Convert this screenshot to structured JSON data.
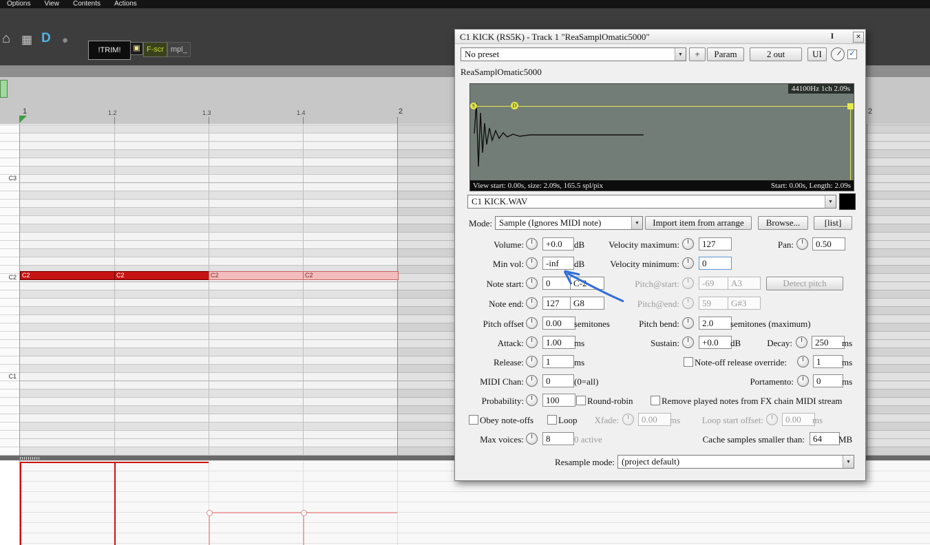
{
  "icons": {
    "home": "⌂",
    "grid": "▦",
    "reaper": "D",
    "monitor": "●",
    "clip": "▣",
    "dropdown": "▼",
    "close": "✕",
    "dock": "I",
    "check": "✓"
  },
  "menu": {
    "items": [
      "Options",
      "View",
      "Contents",
      "Actions"
    ]
  },
  "toolbar": {
    "trim": "!TRIM!",
    "fscr": "F-scr",
    "mpl": "mpl_"
  },
  "ruler": {
    "ticks": [
      "1",
      "1.2",
      "1.3",
      "1.4",
      "2"
    ],
    "right_tick": "2"
  },
  "keys": {
    "labels": [
      "C3",
      "C2",
      "C1"
    ]
  },
  "note": {
    "label": "C2"
  },
  "fx": {
    "title": "C1 KICK (RS5K) - Track 1 \"ReaSamplOmatic5000\"",
    "preset_value": "No preset",
    "add_btn": "+",
    "param_btn": "Param",
    "out_btn": "2 out",
    "ui_btn": "UI",
    "plugin_name": "ReaSamplOmatic5000",
    "wave": {
      "info": "44100Hz 1ch 2.09s",
      "start_marker": "S",
      "loop_marker": "D",
      "view_info": "View start: 0.00s, size: 2.09s, 165.5 spl/pix",
      "range_info": "Start: 0.00s, Length: 2.09s"
    },
    "sample_value": "C1 KICK.WAV",
    "mode_label": "Mode:",
    "mode_value": "Sample (Ignores MIDI note)",
    "import_btn": "Import item from arrange",
    "browse_btn": "Browse...",
    "list_btn": "[list]",
    "params": {
      "volume": {
        "label": "Volume:",
        "value": "+0.0",
        "unit": "dB"
      },
      "vel_max": {
        "label": "Velocity maximum:",
        "value": "127"
      },
      "pan": {
        "label": "Pan:",
        "value": "0.50"
      },
      "min_vol": {
        "label": "Min vol:",
        "value": "-inf",
        "unit": "dB"
      },
      "vel_min": {
        "label": "Velocity minimum:",
        "value": "0"
      },
      "note_start": {
        "label": "Note start:",
        "value": "0",
        "note": "C-2"
      },
      "pitch_start": {
        "label": "Pitch@start:",
        "value": "-69",
        "note": "A3"
      },
      "detect_btn": "Detect pitch",
      "note_end": {
        "label": "Note end:",
        "value": "127",
        "note": "G8"
      },
      "pitch_end": {
        "label": "Pitch@end:",
        "value": "59",
        "note": "G#3"
      },
      "pitch_offset": {
        "label": "Pitch offset",
        "value": "0.00",
        "unit": "semitones"
      },
      "pitch_bend": {
        "label": "Pitch bend:",
        "value": "2.0",
        "unit": "semitones (maximum)"
      },
      "attack": {
        "label": "Attack:",
        "value": "1.00",
        "unit": "ms"
      },
      "sustain": {
        "label": "Sustain:",
        "value": "+0.0",
        "unit": "dB"
      },
      "decay": {
        "label": "Decay:",
        "value": "250",
        "unit": "ms"
      },
      "release": {
        "label": "Release:",
        "value": "1",
        "unit": "ms"
      },
      "noteoff_override": {
        "label": "Note-off release override:",
        "value": "1",
        "unit": "ms"
      },
      "midi_chan": {
        "label": "MIDI Chan:",
        "value": "0",
        "unit": "(0=all)"
      },
      "portamento": {
        "label": "Portamento:",
        "value": "0",
        "unit": "ms"
      },
      "probability": {
        "label": "Probability:",
        "value": "100"
      },
      "round_robin_label": "Round-robin",
      "remove_played_label": "Remove played notes from FX chain MIDI stream",
      "obey_label": "Obey note-offs",
      "loop_label": "Loop",
      "xfade": {
        "label": "Xfade:",
        "value": "0.00",
        "unit": "ms"
      },
      "loop_start": {
        "label": "Loop start offset:",
        "value": "0.00",
        "unit": "ms"
      },
      "max_voices": {
        "label": "Max voices:",
        "value": "8",
        "active": "0 active"
      },
      "cache": {
        "label": "Cache samples smaller than:",
        "value": "64",
        "unit": "MB"
      },
      "resample": {
        "label": "Resample mode:",
        "value": "(project default)"
      }
    }
  }
}
